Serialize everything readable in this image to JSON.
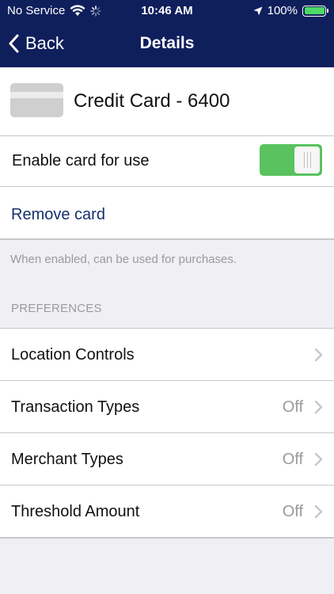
{
  "status_bar": {
    "carrier": "No Service",
    "time": "10:46 AM",
    "battery_percent": "100%",
    "battery_level": 1.0,
    "icons": [
      "wifi-icon",
      "activity-spinner-icon",
      "location-arrow-icon",
      "battery-charging-icon"
    ]
  },
  "nav": {
    "back_label": "Back",
    "title": "Details",
    "background_color": "#0f1f5c"
  },
  "card": {
    "title": "Credit Card - 6400",
    "icon": "credit-card-icon"
  },
  "enable_toggle": {
    "label": "Enable card for use",
    "enabled": true,
    "on_color": "#5ac25f"
  },
  "remove": {
    "label": "Remove card",
    "color": "#16306e"
  },
  "hint": "When enabled, can be used for purchases.",
  "preferences": {
    "header": "PREFERENCES",
    "items": [
      {
        "label": "Location Controls",
        "value": ""
      },
      {
        "label": "Transaction Types",
        "value": "Off"
      },
      {
        "label": "Merchant Types",
        "value": "Off"
      },
      {
        "label": "Threshold Amount",
        "value": "Off"
      }
    ]
  }
}
